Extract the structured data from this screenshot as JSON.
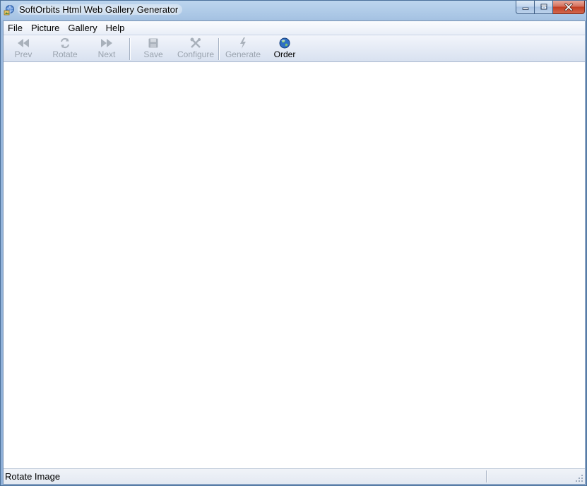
{
  "window": {
    "title": "SoftOrbits Html Web Gallery Generator",
    "icons": {
      "app": "gallery-globe-icon",
      "minimize": "minimize-icon",
      "maximize": "maximize-icon",
      "close": "close-icon"
    }
  },
  "menu": {
    "items": [
      {
        "label": "File"
      },
      {
        "label": "Picture"
      },
      {
        "label": "Gallery"
      },
      {
        "label": "Help"
      }
    ]
  },
  "toolbar": {
    "buttons": [
      {
        "label": "Prev",
        "icon": "arrow-left-icon",
        "enabled": false
      },
      {
        "label": "Rotate",
        "icon": "rotate-icon",
        "enabled": false
      },
      {
        "label": "Next",
        "icon": "arrow-right-icon",
        "enabled": false
      },
      {
        "label": "Save",
        "icon": "save-icon",
        "enabled": false
      },
      {
        "label": "Configure",
        "icon": "configure-tools-icon",
        "enabled": false
      },
      {
        "label": "Generate",
        "icon": "lightning-icon",
        "enabled": false
      },
      {
        "label": "Order",
        "icon": "globe-icon",
        "enabled": true
      }
    ]
  },
  "statusbar": {
    "text": "Rotate Image",
    "secondary": ""
  },
  "colors": {
    "disabled_text": "#9aa3ae",
    "title_bar": "#a6c3e3",
    "close_button": "#c23c20"
  }
}
